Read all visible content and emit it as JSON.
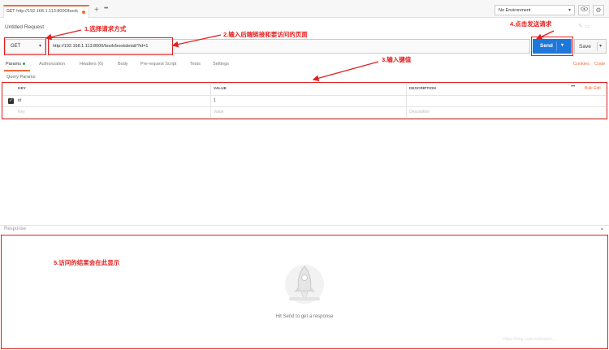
{
  "tab": {
    "method": "GET",
    "title": "http://192.168.1.113:8000/book"
  },
  "topbar": {
    "plus": "+",
    "more": "•••",
    "environment": "No Environment"
  },
  "request": {
    "title": "Untitled Request",
    "method": "GET",
    "url": "http://192.168.1.113:8000/book/bookdetail/?id=1",
    "send_label": "Send",
    "save_label": "Save"
  },
  "tabs": [
    {
      "label": "Params"
    },
    {
      "label": "Authorization"
    },
    {
      "label": "Headers (6)"
    },
    {
      "label": "Body"
    },
    {
      "label": "Pre-request Script"
    },
    {
      "label": "Tests"
    },
    {
      "label": "Settings"
    }
  ],
  "links": {
    "cookies": "Cookies",
    "code": "Code",
    "bulk_edit": "Bulk Edit"
  },
  "query_params": {
    "title": "Query Params",
    "columns": [
      "KEY",
      "VALUE",
      "DESCRIPTION"
    ],
    "rows": [
      {
        "key": "id",
        "value": "1",
        "description": ""
      }
    ],
    "placeholders": {
      "key": "Key",
      "value": "Value",
      "description": "Description"
    }
  },
  "response": {
    "label": "Response",
    "hint": "Hit Send to get a response"
  },
  "annotations": {
    "a1": "1.选择请求方式",
    "a2": "2.输入后端链接和要访问的页面",
    "a3": "3.输入键值",
    "a4": "4.点击发送请求",
    "a5": "5.访问的结果会在此显示"
  },
  "watermark": "https://blog.csdn.net/weixin_...",
  "colors": {
    "accent": "#f26b3a",
    "send": "#1f77d9",
    "annotation": "#e02020"
  }
}
